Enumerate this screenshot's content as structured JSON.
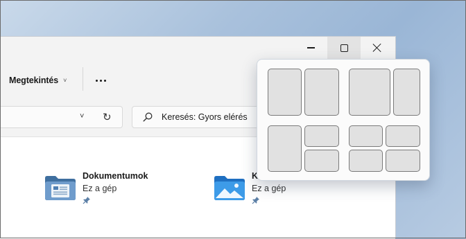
{
  "titlebar": {
    "buttons": [
      {
        "name": "minimize",
        "icon": "minimize-icon"
      },
      {
        "name": "maximize",
        "icon": "maximize-icon"
      },
      {
        "name": "close",
        "icon": "close-icon"
      }
    ]
  },
  "toolbar": {
    "view_label": "Megtekintés",
    "view_chevron": "˅",
    "more_icon": "more-options-icon"
  },
  "address": {
    "dropdown_chevron": "˅",
    "refresh_glyph": "↻"
  },
  "search": {
    "placeholder": "Keresés: Gyors elérés",
    "icon": "search-icon"
  },
  "quick_access": {
    "items": [
      {
        "name": "Dokumentumok",
        "location": "Ez a gép",
        "icon": "documents-folder-icon",
        "pinned": true
      },
      {
        "name": "K",
        "location": "Ez a gép",
        "icon": "pictures-folder-icon",
        "pinned": true
      }
    ]
  },
  "snap_layouts": {
    "groups": [
      {
        "layout": "two-equal-columns",
        "zones": 2
      },
      {
        "layout": "wide-left-narrow-right",
        "zones": 2
      },
      {
        "layout": "left-column-two-right-rows",
        "zones": 3
      },
      {
        "layout": "two-by-two-grid",
        "zones": 4
      }
    ]
  },
  "colors": {
    "window_chrome": "#f3f3f3",
    "snap_tile": "#e1e1e1",
    "snap_tile_border": "#7a7a7a",
    "desktop": "#a9c1dc"
  }
}
